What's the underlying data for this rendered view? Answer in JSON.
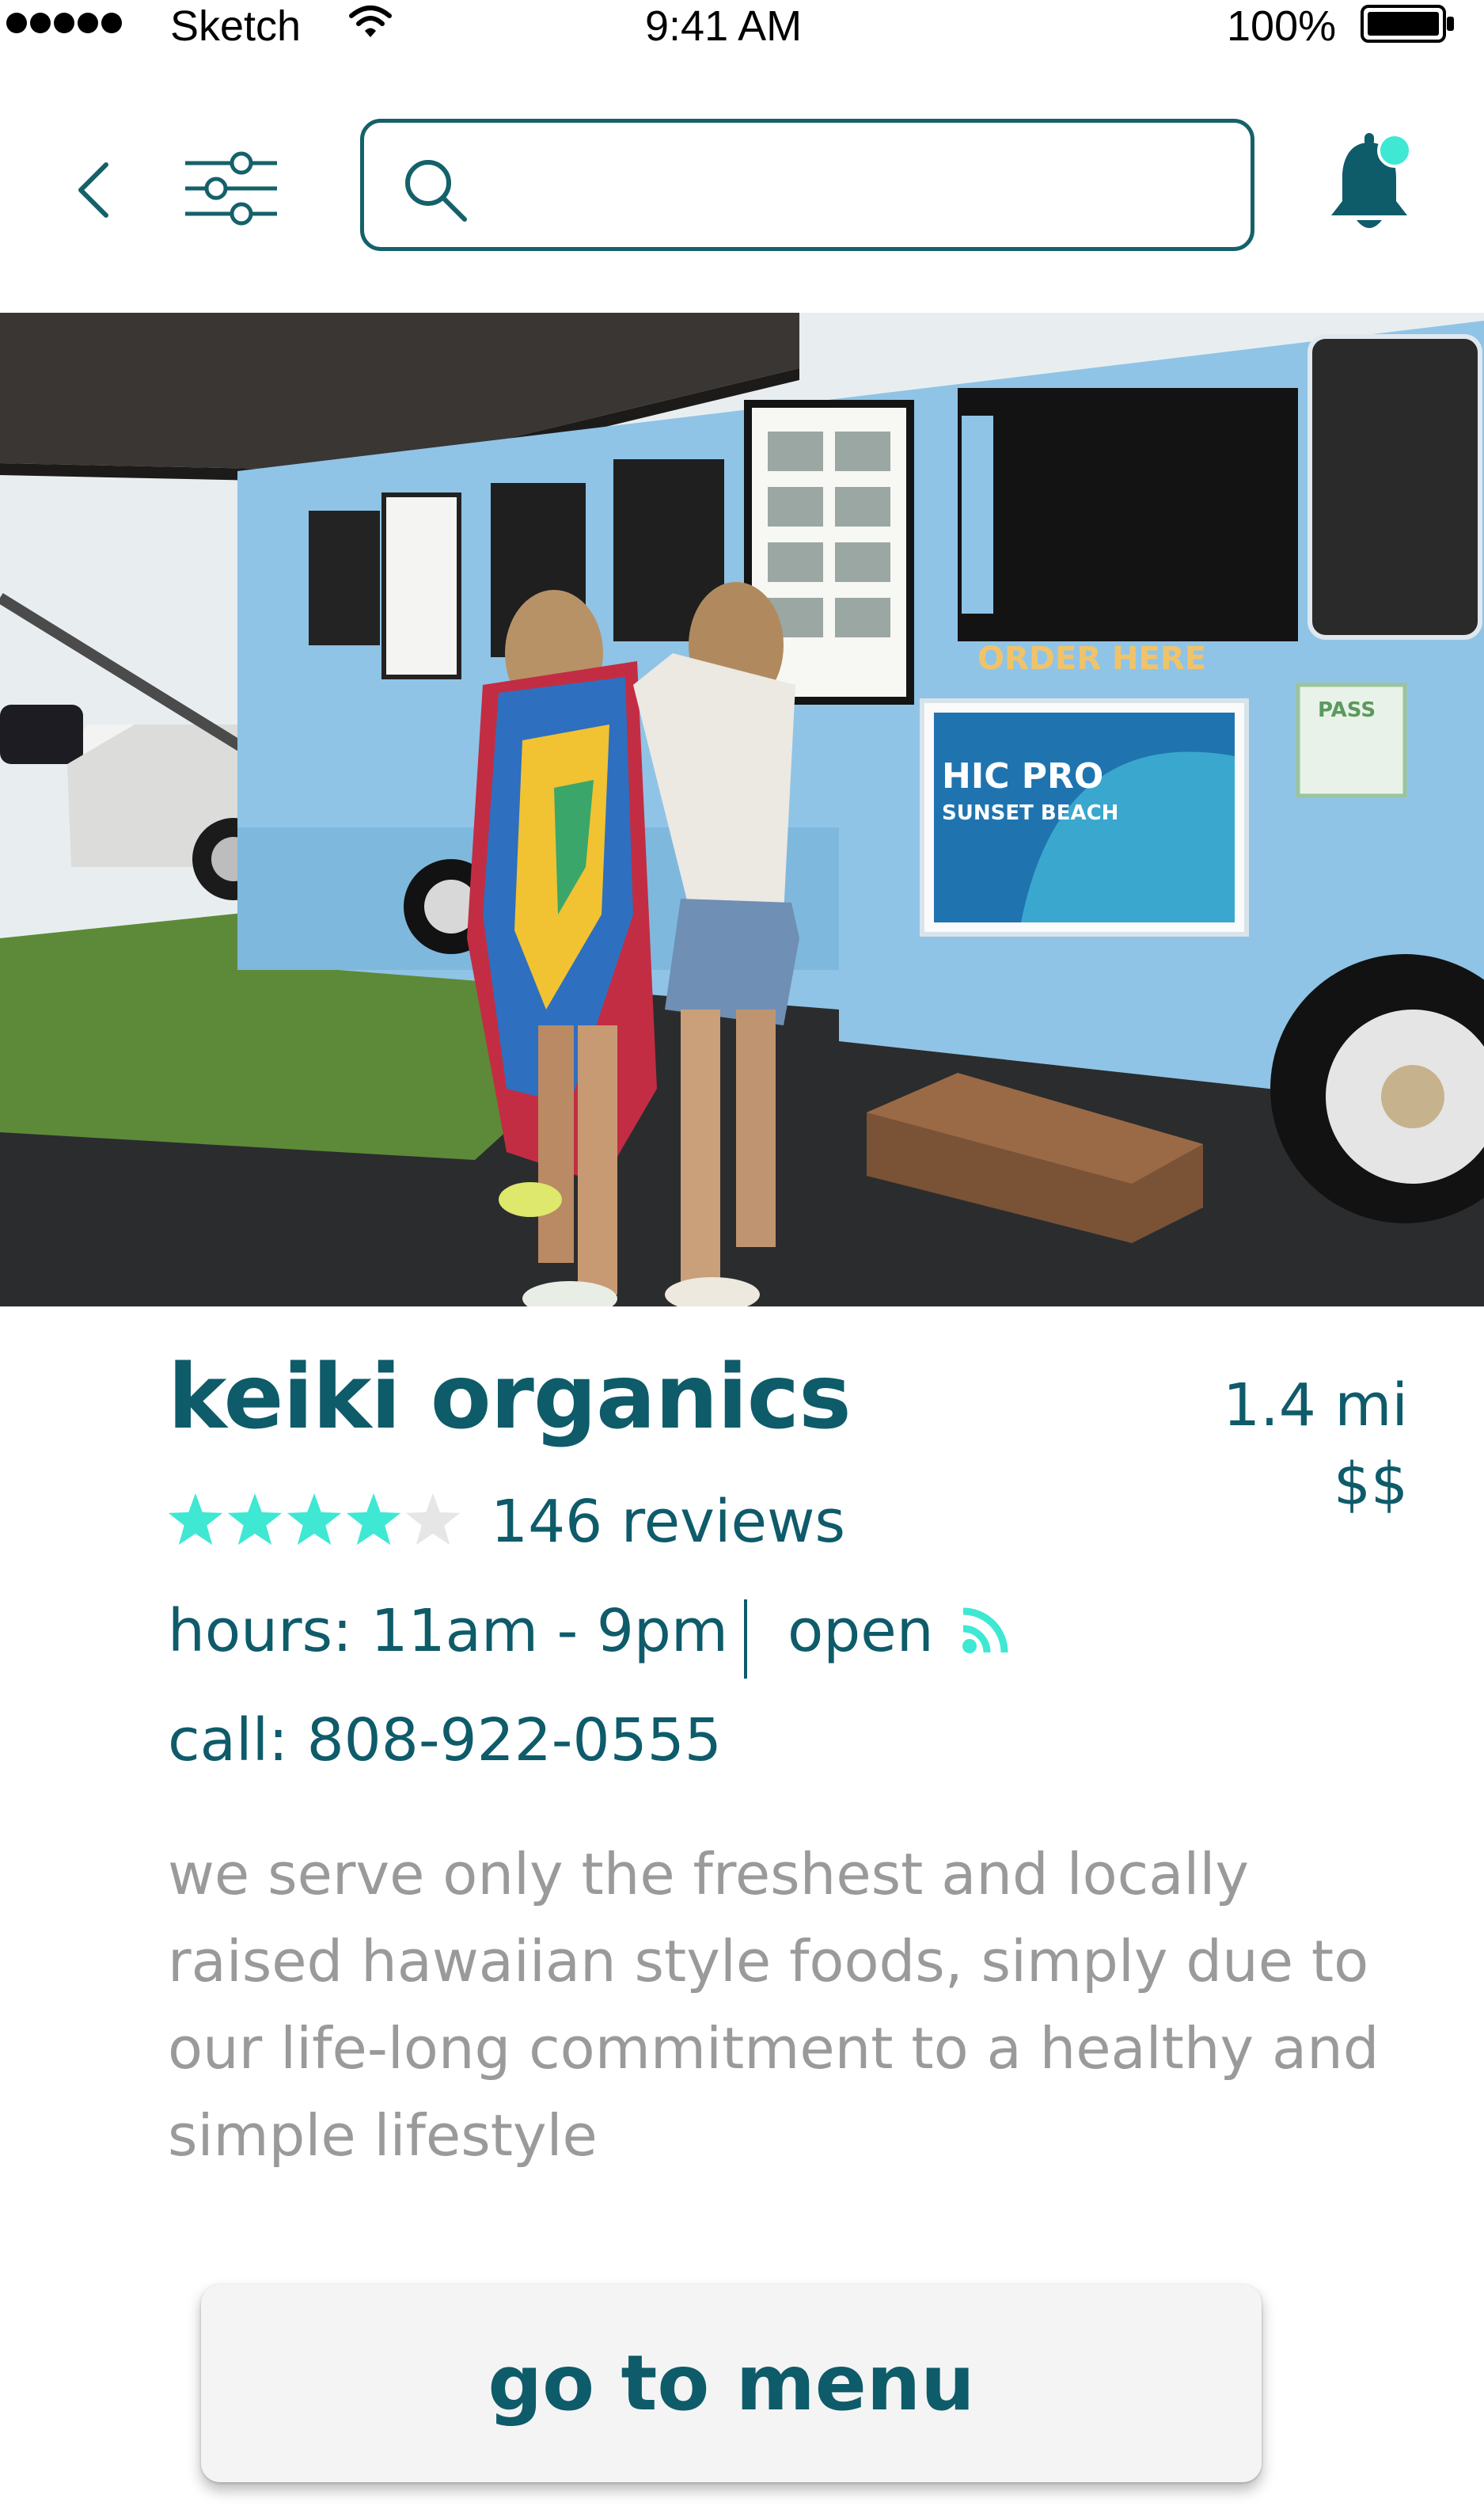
{
  "status_bar": {
    "carrier": "Sketch",
    "time": "9:41 AM",
    "battery": "100%"
  },
  "nav": {
    "back_icon": "chevron-left-icon",
    "filter_icon": "sliders-icon",
    "search_icon": "search-icon",
    "search_value": "",
    "notification_icon": "bell-icon"
  },
  "hero": {
    "sign_text": "ORDER HERE",
    "poster_title": "HIC PRO",
    "poster_subtitle": "SUNSET BEACH",
    "pass_text": "PASS"
  },
  "listing": {
    "name": "keiki organics",
    "distance": "1.4 mi",
    "price": "$$",
    "rating": 4,
    "rating_max": 5,
    "reviews": "146 reviews",
    "hours": "hours: 11am - 9pm",
    "status": "open",
    "call": "call: 808-922-0555",
    "description": "we serve only the freshest and locally raised hawaiian style foods, simply due to our life-long commitment to a healthy and simple lifestyle"
  },
  "actions": {
    "menu_button": "go to menu"
  },
  "colors": {
    "primary": "#0e5b6a",
    "accent": "#3ee8d3",
    "star_empty": "#e6e6e6",
    "muted_text": "#9a9a9a"
  }
}
